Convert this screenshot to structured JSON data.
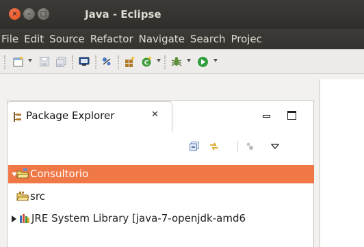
{
  "window": {
    "title": "Java - Eclipse",
    "close_glyph": "×",
    "min_glyph": "–",
    "max_glyph": "□"
  },
  "menubar": {
    "items": [
      "File",
      "Edit",
      "Source",
      "Refactor",
      "Navigate",
      "Search",
      "Projec"
    ]
  },
  "toolbar": {
    "icons": [
      "new-wizard-icon",
      "save-icon",
      "save-all-icon",
      "console-icon",
      "toggle-breakpoint-icon",
      "new-java-package-icon",
      "new-java-class-icon",
      "debug-icon",
      "run-icon"
    ]
  },
  "package_explorer": {
    "tab_label": "Package Explorer",
    "tab_close_glyph": "✕",
    "view_toolbar_icons": [
      "collapse-all-icon",
      "link-with-editor-icon",
      "focus-icon",
      "view-menu-icon"
    ],
    "tree": {
      "project": "Consultorio",
      "src": "src",
      "library": "JRE System Library [java-7-openjdk-amd6"
    }
  },
  "colors": {
    "selection": "#f07746",
    "titlebar": "#3c3b37",
    "menubar_text": "#dfdbd2"
  }
}
